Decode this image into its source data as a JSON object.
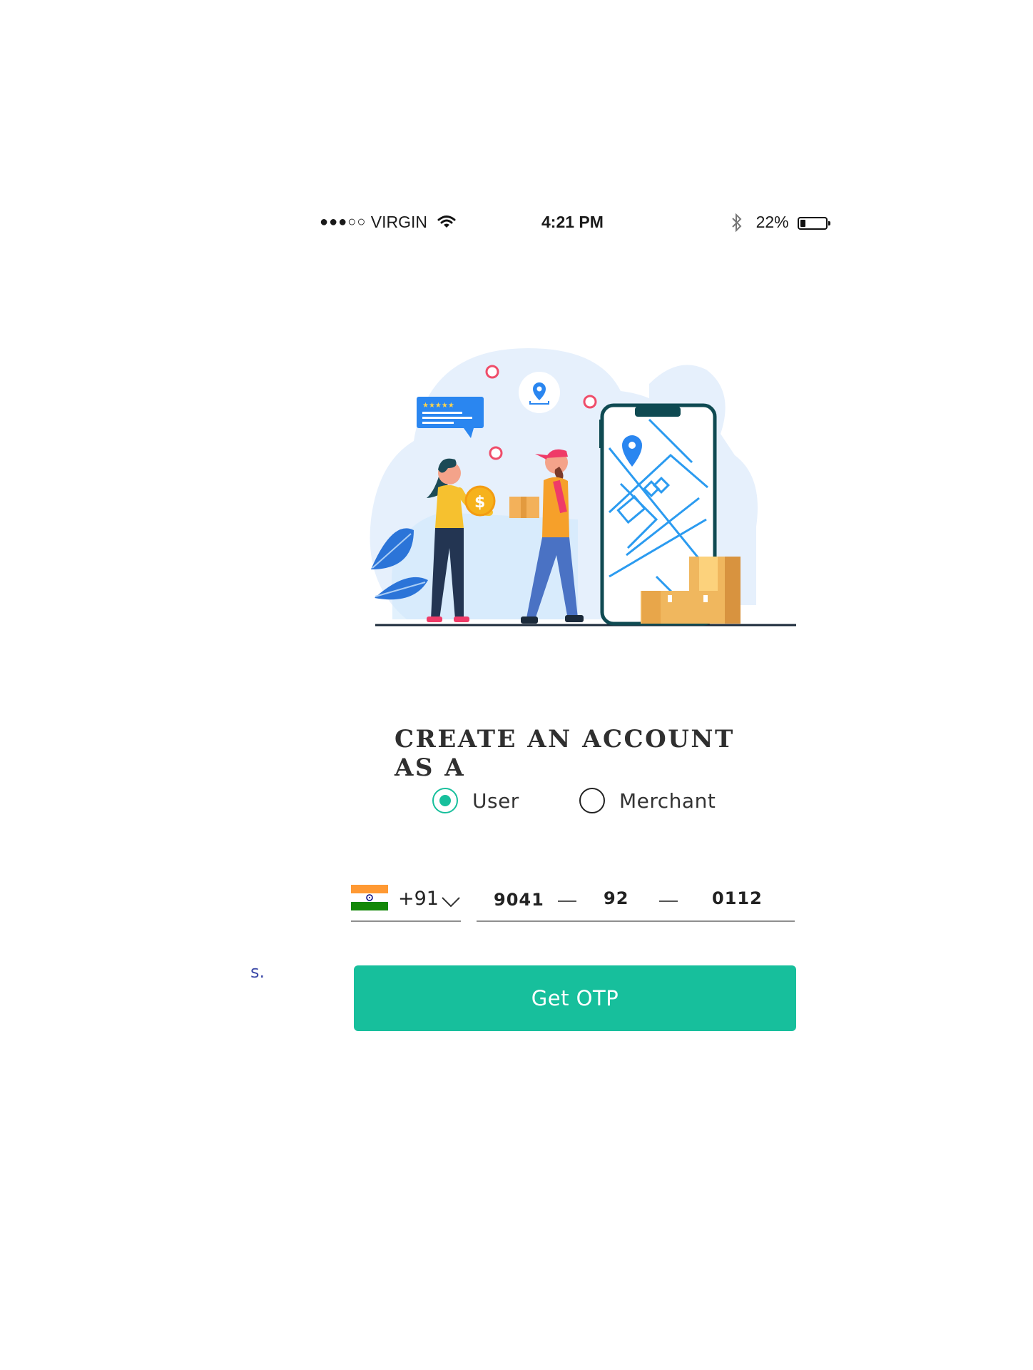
{
  "status_bar": {
    "signal": "●●●○○",
    "carrier": "VIRGIN",
    "time": "4:21 PM",
    "battery": "22%",
    "battery_level": 0.22
  },
  "hero": {
    "icons": [
      "delivery-illustration",
      "smartphone-map-icon",
      "location-pin-icon",
      "review-stars-bubble-icon",
      "heart-icon",
      "coin-icon",
      "parcel-box-icon"
    ],
    "colors": {
      "phone": "#0f4a52",
      "map_lines": "#2b9bf0",
      "blob": "#e3effd",
      "boxes": "#f0b75e"
    }
  },
  "form": {
    "heading": "CREATE AN ACCOUNT AS A",
    "account_types": [
      {
        "label": "User",
        "selected": true
      },
      {
        "label": "Merchant",
        "selected": false
      }
    ],
    "phone": {
      "country_flag": "india-flag-icon",
      "country_code": "+91",
      "part1": "9041",
      "part2": "92",
      "part3": "0112"
    },
    "submit_label": "Get OTP",
    "stray_text": "s."
  },
  "colors": {
    "accent": "#17bf9c",
    "text": "#2f2f2f",
    "stray_text": "#3d4aa8"
  }
}
